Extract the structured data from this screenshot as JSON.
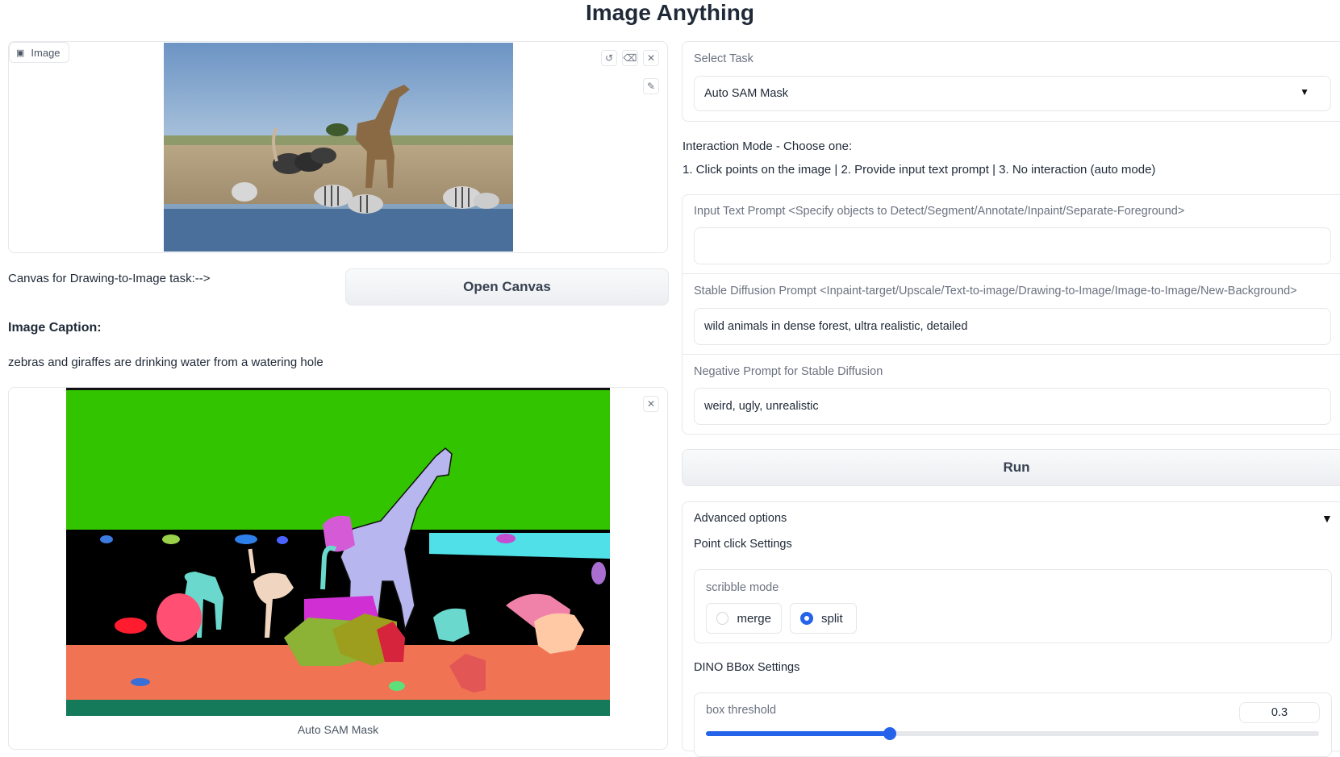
{
  "app": {
    "title": "Image Anything"
  },
  "input_image": {
    "label": "Image",
    "label_icon": "image-icon",
    "tools": [
      "undo-icon",
      "eraser-icon",
      "close-icon",
      "brush-icon"
    ]
  },
  "canvas": {
    "label": "Canvas for Drawing-to-Image task:-->",
    "button": "Open Canvas"
  },
  "caption": {
    "heading": "Image Caption:",
    "text": "zebras and giraffes are drinking water from a watering hole"
  },
  "output_image": {
    "label": "Auto SAM Mask"
  },
  "task": {
    "label": "Select Task",
    "value": "Auto SAM Mask"
  },
  "interaction": {
    "title": "Interaction Mode - Choose one:",
    "options": "1. Click points on the image | 2. Provide input text prompt | 3. No interaction (auto mode)"
  },
  "text_prompt": {
    "label": "Input Text Prompt <Specify objects to Detect/Segment/Annotate/Inpaint/Separate-Foreground>",
    "value": ""
  },
  "sd_prompt": {
    "label": "Stable Diffusion Prompt <Inpaint-target/Upscale/Text-to-image/Drawing-to-Image/Image-to-Image/New-Background>",
    "value": "wild animals in dense forest, ultra realistic, detailed"
  },
  "neg_prompt": {
    "label": "Negative Prompt for Stable Diffusion",
    "value": "weird, ugly, unrealistic"
  },
  "run_button": "Run",
  "advanced": {
    "label": "Advanced options",
    "toggle": "▼",
    "point_click": "Point click Settings",
    "scribble": {
      "label": "scribble mode",
      "options": [
        "merge",
        "split"
      ],
      "selected": "split"
    },
    "dino": "DINO BBox Settings",
    "box_threshold": {
      "label": "box threshold",
      "value": "0.3",
      "fraction": 0.3
    }
  },
  "colors": {
    "accent": "#2563eb",
    "mask_bg": "#33c400",
    "mask_ground": "#f07353"
  }
}
